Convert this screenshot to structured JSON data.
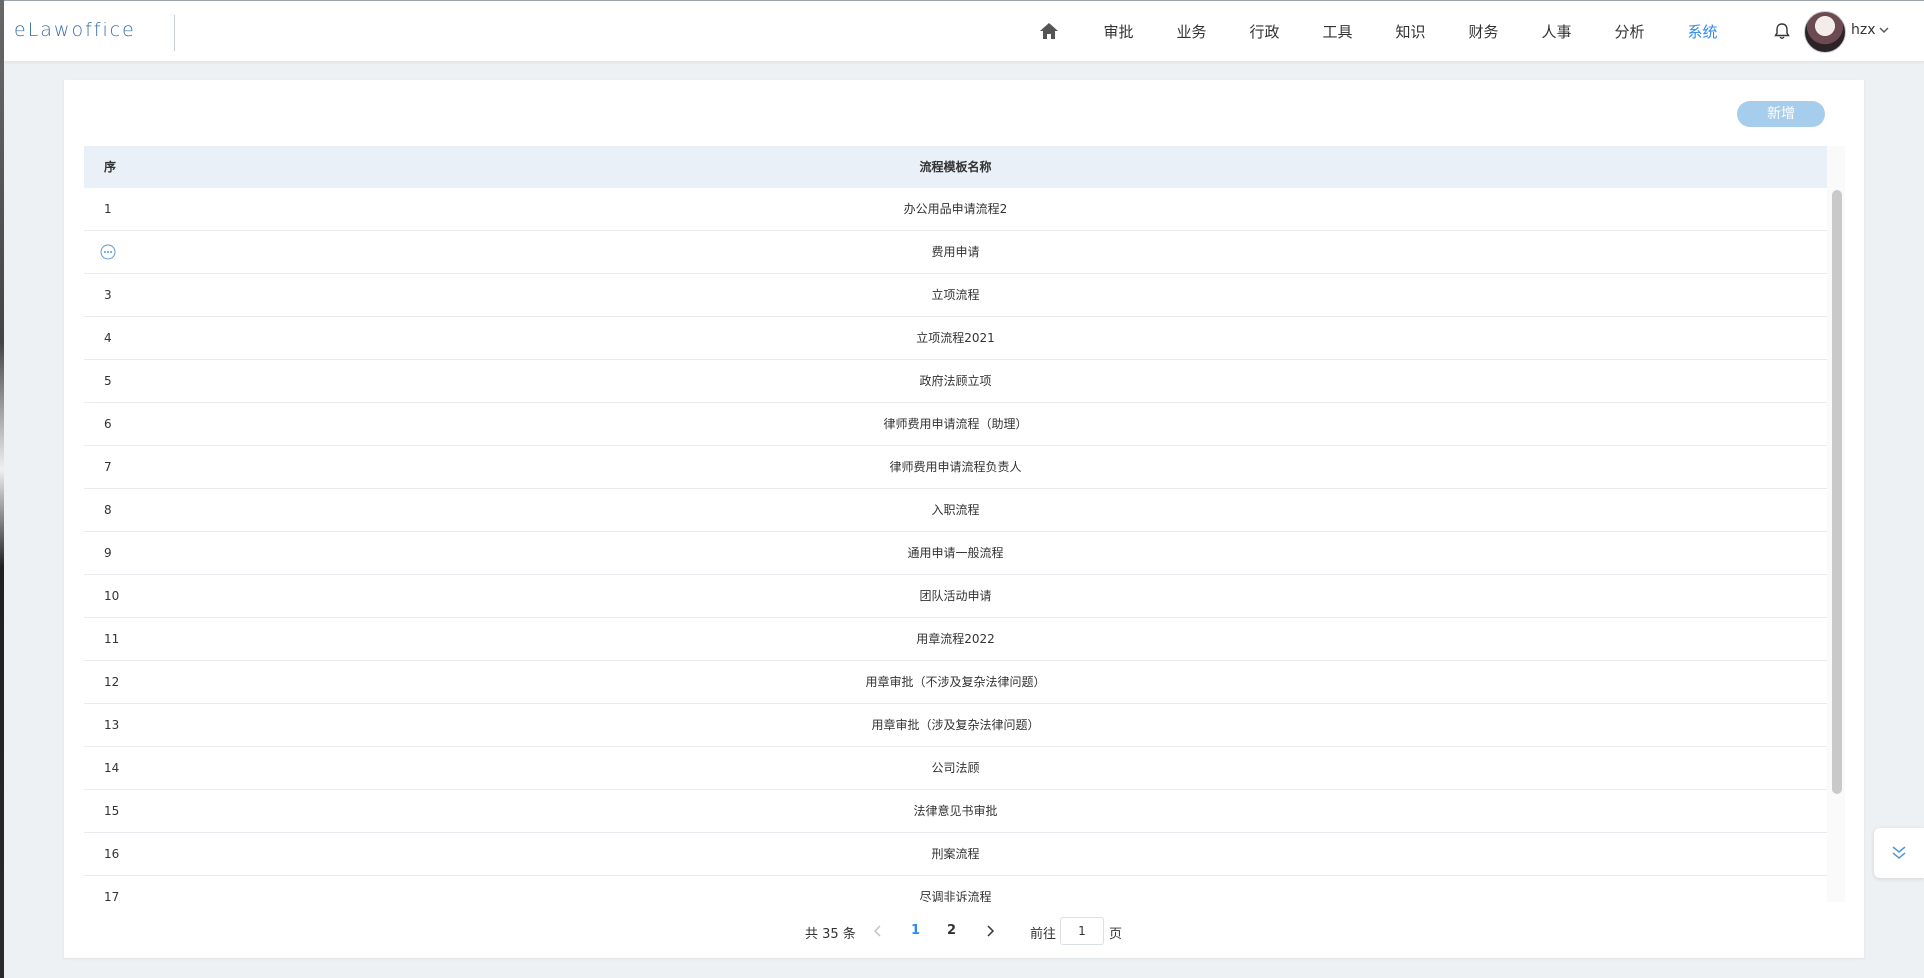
{
  "app": {
    "logo_text": "eLawoffice"
  },
  "nav": {
    "items": [
      {
        "label": "审批",
        "active": false
      },
      {
        "label": "业务",
        "active": false
      },
      {
        "label": "行政",
        "active": false
      },
      {
        "label": "工具",
        "active": false
      },
      {
        "label": "知识",
        "active": false
      },
      {
        "label": "财务",
        "active": false
      },
      {
        "label": "人事",
        "active": false
      },
      {
        "label": "分析",
        "active": false
      },
      {
        "label": "系统",
        "active": true
      }
    ]
  },
  "user": {
    "name": "hzx"
  },
  "toolbar": {
    "add_label": "新增"
  },
  "table": {
    "columns": {
      "index": "序",
      "name": "流程模板名称"
    },
    "rows": [
      {
        "index": "1",
        "name": "办公用品申请流程2"
      },
      {
        "index": "",
        "name": "费用申请",
        "hover_more": true
      },
      {
        "index": "3",
        "name": "立项流程"
      },
      {
        "index": "4",
        "name": "立项流程2021"
      },
      {
        "index": "5",
        "name": "政府法顾立项"
      },
      {
        "index": "6",
        "name": "律师费用申请流程（助理）"
      },
      {
        "index": "7",
        "name": "律师费用申请流程负责人"
      },
      {
        "index": "8",
        "name": "入职流程"
      },
      {
        "index": "9",
        "name": "通用申请一般流程"
      },
      {
        "index": "10",
        "name": "团队活动申请"
      },
      {
        "index": "11",
        "name": "用章流程2022"
      },
      {
        "index": "12",
        "name": "用章审批（不涉及复杂法律问题）"
      },
      {
        "index": "13",
        "name": "用章审批（涉及复杂法律问题）"
      },
      {
        "index": "14",
        "name": "公司法顾"
      },
      {
        "index": "15",
        "name": "法律意见书审批"
      },
      {
        "index": "16",
        "name": "刑案流程"
      },
      {
        "index": "17",
        "name": "尽调非诉流程"
      }
    ]
  },
  "pagination": {
    "total_text": "共 35 条",
    "pages": [
      "1",
      "2"
    ],
    "current_page": "1",
    "goto_label": "前往",
    "goto_value": "1",
    "page_unit": "页"
  },
  "colors": {
    "accent": "#2d8cf0",
    "add_button": "#a6cdec",
    "header_bg": "#e9f0f7"
  }
}
